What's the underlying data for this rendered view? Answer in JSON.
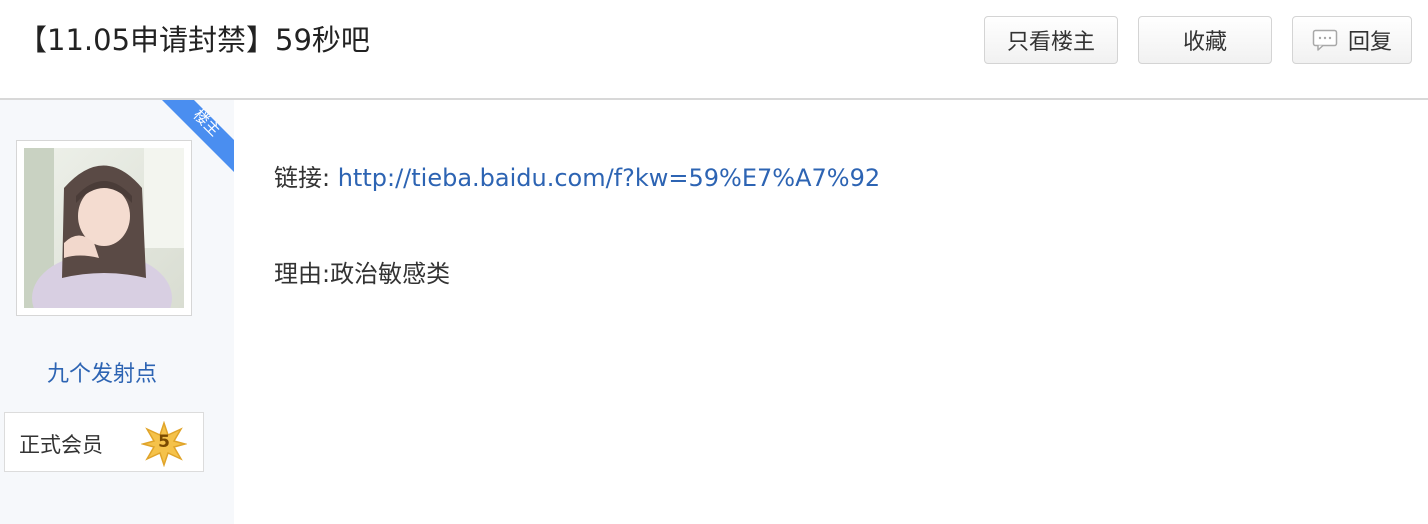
{
  "header": {
    "title": "【11.05申请封禁】59秒吧",
    "buttons": {
      "only_author": "只看楼主",
      "favorite": "收藏",
      "reply": "回复"
    }
  },
  "author": {
    "badge": "楼主",
    "name": "九个发射点",
    "member_title": "正式会员",
    "level": "5"
  },
  "post": {
    "link_label": "链接: ",
    "link_url": "http://tieba.baidu.com/f?kw=59%E7%A7%92",
    "reason": "理由:政治敏感类"
  },
  "colors": {
    "link": "#2d64b3",
    "badge": "#4a8ef0",
    "level_star": "#f5c24a"
  }
}
